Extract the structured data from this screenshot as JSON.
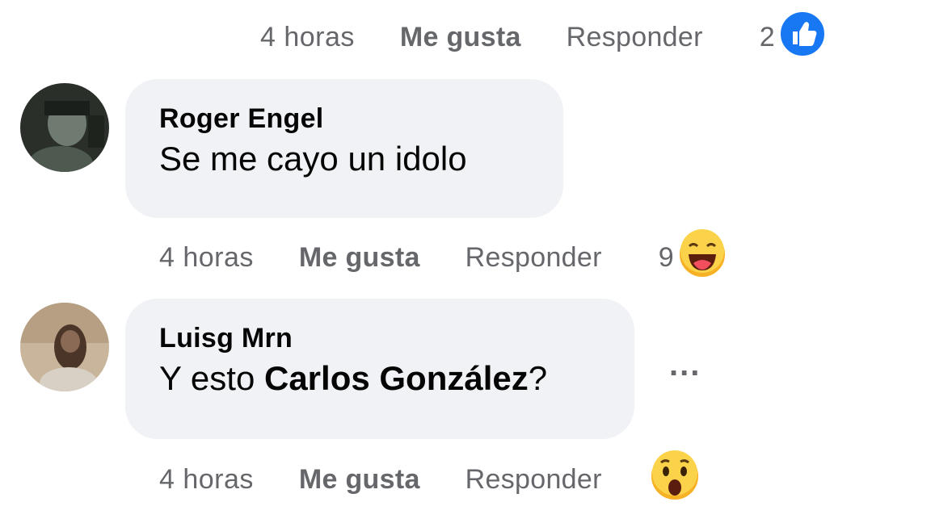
{
  "top_actions": {
    "time": "4 horas",
    "like": "Me gusta",
    "reply": "Responder",
    "reaction_count": "2",
    "reaction_icon": "like-icon",
    "reaction_color": "#1877f2"
  },
  "comments": [
    {
      "author": "Roger Engel",
      "text": "Se me cayo un idolo",
      "time": "4 horas",
      "like": "Me gusta",
      "reply": "Responder",
      "reaction_count": "9",
      "reaction_icon": "haha-icon"
    },
    {
      "author": "Luisg Mrn",
      "text_prefix": "Y esto ",
      "mention": "Carlos González",
      "text_suffix": "?",
      "time": "4 horas",
      "like": "Me gusta",
      "reply": "Responder",
      "reaction_icon": "wow-icon",
      "more_label": "..."
    }
  ]
}
